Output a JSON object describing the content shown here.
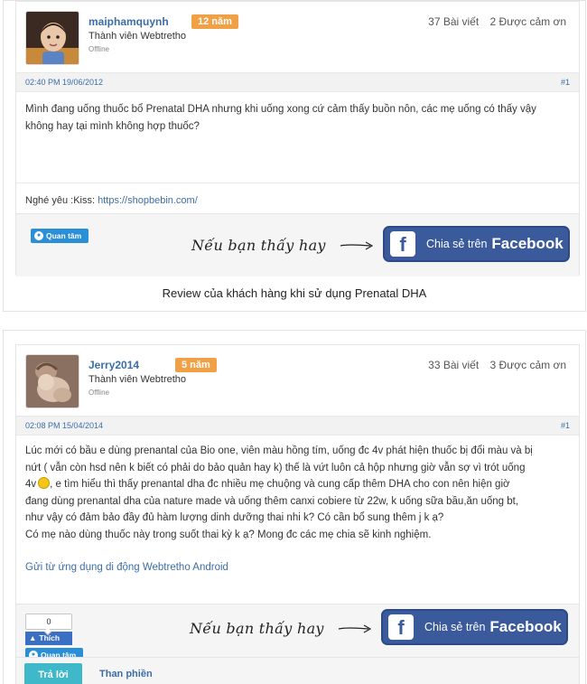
{
  "post1": {
    "username": "maiphamquynh",
    "badge": "12 năm",
    "role": "Thành viên Webtretho",
    "status": "Offline",
    "posts": "37 Bài viết",
    "thanks": "2 Được cảm ơn",
    "datetime": "02:40 PM 19/06/2012",
    "number": "#1",
    "body": "Mình đang uống thuốc bổ Prenatal DHA nhưng khi uống xong cứ cảm thấy buồn nôn, các mẹ uống có thấy vậy không hay tại mình không hợp thuốc?",
    "signature_prefix": "Nghé yêu :Kiss: ",
    "signature_link": "https://shopbebin.com/",
    "follow_label": "Quan tâm",
    "share_hint": "Nếu bạn thấy hay",
    "share_label": "Chia sẻ trên",
    "share_brand": "Facebook"
  },
  "caption": "Review của khách hàng khi sử dụng Prenatal DHA",
  "post2": {
    "username": "Jerry2014",
    "badge": "5 năm",
    "role": "Thành viên Webtretho",
    "status": "Offline",
    "posts": "33 Bài viết",
    "thanks": "3 Được cảm ơn",
    "datetime": "02:08 PM 15/04/2014",
    "number": "#1",
    "body_lines": [
      "Lúc mới có bầu e dùng prenantal của Bio one, viên màu hồng tím, uống đc 4v phát hiện thuốc bị đổi màu và bị",
      "nứt ( vẫn còn hsd nên k biết có phải do bảo quản hay k) thế là vứt luôn cả hộp nhưng giờ vẫn sợ vì trót uống",
      "4v",
      ", e tìm hiểu thì thấy prenantal dha đc nhiều mẹ chuộng và cung cấp thêm DHA cho con nên hiện giờ",
      "đang dùng prenantal dha của nature made và uống thêm canxi cobiere từ 22w, k uống sữa bầu,ăn uống bt,",
      "như vậy có đảm bảo đầy đủ hàm lượng dinh dưỡng thai nhi k? Có cần bổ sung thêm j k ạ?",
      "Có mẹ nào dùng thuốc này trong suốt thai kỳ k ạ? Mong đc các mẹ chia sẽ kinh nghiệm."
    ],
    "app_link": "Gửi từ ứng dụng di động Webtretho Android",
    "like_count": "0",
    "like_label": "Thích",
    "follow_label": "Quan tâm",
    "share_hint": "Nếu bạn thấy hay",
    "share_label": "Chia sẻ trên",
    "share_brand": "Facebook",
    "reply_label": "Trả lời",
    "complain_label": "Than phiền"
  }
}
